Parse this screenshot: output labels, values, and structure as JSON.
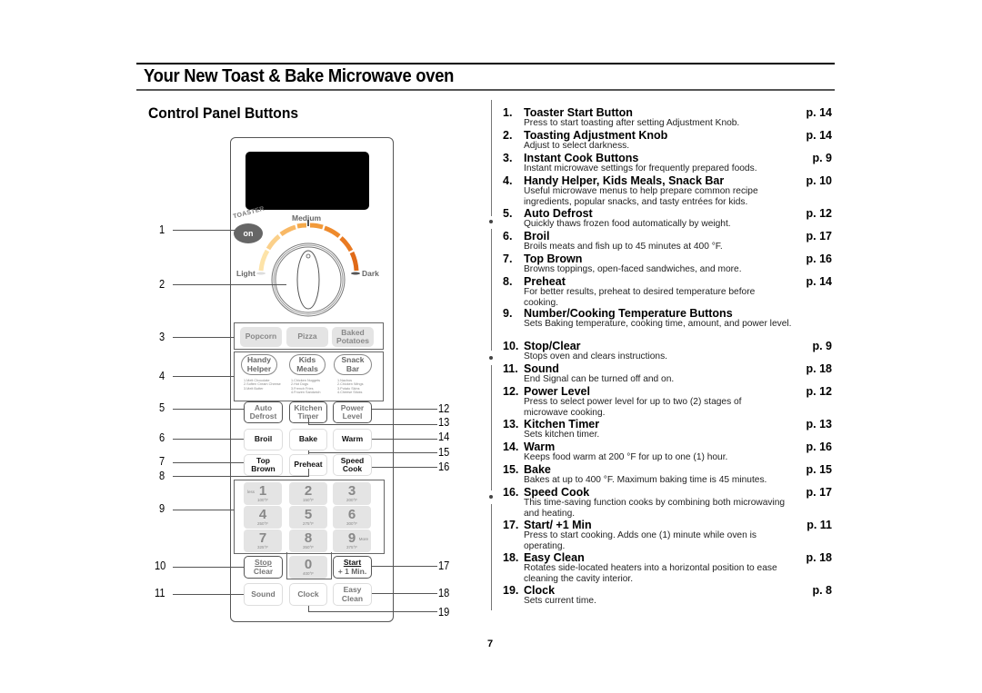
{
  "header": {
    "title": "Your New Toast & Bake Microwave oven",
    "section_title": "Control Panel Buttons"
  },
  "panel": {
    "toaster_label": "TOASTER",
    "toaster_button": "on",
    "knob_labels": {
      "medium": "Medium",
      "light": "Light",
      "dark": "Dark"
    },
    "instant_cook": [
      "Popcorn",
      "Pizza",
      "Baked Potatoes"
    ],
    "menus": [
      {
        "label_1": "Handy",
        "label_2": "Helper",
        "items": [
          "1.Melt Chocolate",
          "2.Soften Cream Cheese",
          "3.Melt Butter"
        ]
      },
      {
        "label_1": "Kids",
        "label_2": "Meals",
        "items": [
          "1.Chicken Nuggets",
          "2.Hot Dogs",
          "3.French Fries",
          "4.Frozen Sandwich"
        ]
      },
      {
        "label_1": "Snack",
        "label_2": "Bar",
        "items": [
          "1.Nachos",
          "2.Chicken Wings",
          "3.Potato Skins",
          "4.Cheese Sticks"
        ]
      }
    ],
    "row_defrost": [
      {
        "l1": "Auto",
        "l2": "Defrost"
      },
      {
        "l1": "Kitchen",
        "l2": "Timer"
      },
      {
        "l1": "Power",
        "l2": "Level"
      }
    ],
    "row_broil": [
      "Broil",
      "Bake",
      "Warm"
    ],
    "row_topbrown": [
      {
        "l1": "Top",
        "l2": "Brown"
      },
      {
        "l1": "Preheat",
        "l2": ""
      },
      {
        "l1": "Speed",
        "l2": "Cook"
      }
    ],
    "keypad": [
      {
        "digit": "1",
        "temp": "100°F",
        "side": "less"
      },
      {
        "digit": "2",
        "temp": "150°F",
        "side": ""
      },
      {
        "digit": "3",
        "temp": "200°F",
        "side": ""
      },
      {
        "digit": "4",
        "temp": "250°F",
        "side": ""
      },
      {
        "digit": "5",
        "temp": "275°F",
        "side": ""
      },
      {
        "digit": "6",
        "temp": "300°F",
        "side": ""
      },
      {
        "digit": "7",
        "temp": "325°F",
        "side": ""
      },
      {
        "digit": "8",
        "temp": "350°F",
        "side": ""
      },
      {
        "digit": "9",
        "temp": "375°F",
        "side": "More"
      },
      {
        "digit": "0",
        "temp": "400°F",
        "side": ""
      }
    ],
    "stop": {
      "l1": "Stop",
      "l2": "Clear"
    },
    "start": {
      "l1": "Start",
      "l2": "+ 1 Min."
    },
    "bottom_row": [
      {
        "l1": "Sound",
        "l2": ""
      },
      {
        "l1": "Clock",
        "l2": ""
      },
      {
        "l1": "Easy",
        "l2": "Clean"
      }
    ]
  },
  "callouts": {
    "left": [
      "1",
      "2",
      "3",
      "4",
      "5",
      "6",
      "7",
      "8",
      "9",
      "10",
      "11"
    ],
    "right": [
      "12",
      "13",
      "14",
      "15",
      "16",
      "17",
      "18",
      "19"
    ]
  },
  "legend": [
    {
      "num": "1.",
      "title": "Toaster Start Button",
      "page": "p. 14",
      "desc": "Press to start toasting after setting Adjustment Knob."
    },
    {
      "num": "2.",
      "title": "Toasting Adjustment Knob",
      "page": "p. 14",
      "desc": "Adjust to select darkness."
    },
    {
      "num": "3.",
      "title": "Instant Cook Buttons",
      "page": "p. 9",
      "desc": "Instant microwave settings for frequently prepared foods."
    },
    {
      "num": "4.",
      "title": "Handy Helper, Kids Meals, Snack Bar",
      "page": "p. 10",
      "desc": "Useful microwave menus to help prepare common recipe ingredients, popular snacks, and tasty entrées for kids."
    },
    {
      "num": "5.",
      "title": "Auto Defrost",
      "page": "p. 12",
      "desc": "Quickly thaws frozen food automatically by weight."
    },
    {
      "num": "6.",
      "title": "Broil",
      "page": "p. 17",
      "desc": "Broils meats and fish up to 45 minutes at 400 °F."
    },
    {
      "num": "7.",
      "title": "Top Brown",
      "page": "p. 16",
      "desc": "Browns toppings, open-faced sandwiches, and more."
    },
    {
      "num": "8.",
      "title": "Preheat",
      "page": "p. 14",
      "desc": "For better results, preheat to desired temperature before cooking."
    },
    {
      "num": "9.",
      "title": "Number/Cooking Temperature Buttons",
      "page": "",
      "desc": "Sets Baking temperature, cooking time, amount, and power level."
    },
    {
      "num": "10.",
      "title": "Stop/Clear",
      "page": "p. 9",
      "desc": "Stops oven and clears instructions."
    },
    {
      "num": "11.",
      "title": "Sound",
      "page": "p. 18",
      "desc": "End Signal can be turned off and on."
    },
    {
      "num": "12.",
      "title": "Power Level",
      "page": "p. 12",
      "desc": "Press to select power level for up to two (2) stages of microwave cooking."
    },
    {
      "num": "13.",
      "title": "Kitchen Timer",
      "page": "p. 13",
      "desc": "Sets kitchen timer."
    },
    {
      "num": "14.",
      "title": "Warm",
      "page": "p. 16",
      "desc": "Keeps food warm at 200 °F for up to one (1) hour."
    },
    {
      "num": "15.",
      "title": "Bake",
      "page": "p. 15",
      "desc": "Bakes at up to 400 °F. Maximum baking time is 45 minutes."
    },
    {
      "num": "16.",
      "title": "Speed Cook",
      "page": "p. 17",
      "desc": "This time-saving function cooks by combining both microwaving and heating."
    },
    {
      "num": "17.",
      "title": "Start/ +1 Min",
      "page": "p. 11",
      "desc": "Press to start cooking. Adds one (1) minute while oven is operating."
    },
    {
      "num": "18.",
      "title": "Easy Clean",
      "page": "p. 18",
      "desc": "Rotates side-located heaters into a horizontal position to ease cleaning the cavity interior."
    },
    {
      "num": "19.",
      "title": "Clock",
      "page": "p. 8",
      "desc": "Sets current time."
    }
  ],
  "footer": {
    "page_number": "7"
  }
}
